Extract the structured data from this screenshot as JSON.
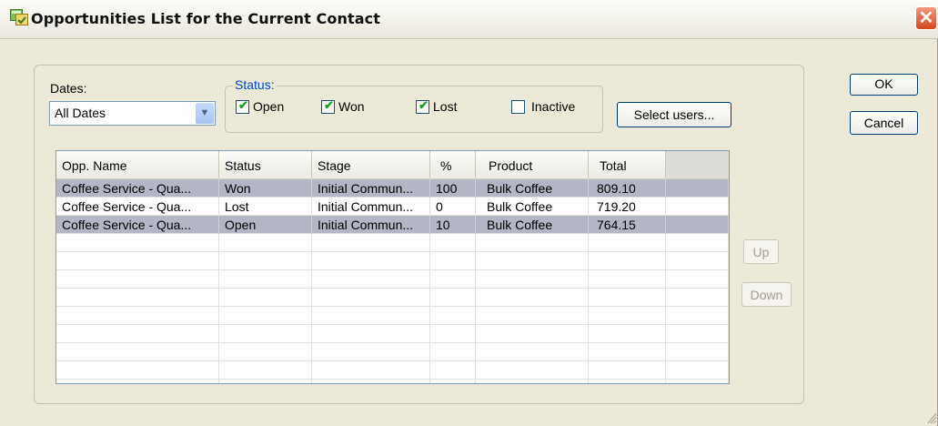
{
  "window": {
    "title": "Opportunities List for the Current Contact",
    "close_label": "✕"
  },
  "buttons": {
    "ok": "OK",
    "cancel": "Cancel",
    "select_users": "Select users...",
    "up": "Up",
    "down": "Down"
  },
  "dates": {
    "label": "Dates:",
    "value": "All Dates"
  },
  "status": {
    "label": "Status:",
    "options": [
      {
        "label": "Open",
        "checked": true
      },
      {
        "label": "Won",
        "checked": true
      },
      {
        "label": "Lost",
        "checked": true
      },
      {
        "label": "Inactive",
        "checked": false
      }
    ]
  },
  "grid": {
    "columns": [
      "Opp. Name",
      "Status",
      "Stage",
      "%",
      "Product",
      "Total"
    ],
    "rows": [
      {
        "cells": [
          "Coffee Service - Qua...",
          "Won",
          "Initial Commun...",
          "100",
          "Bulk Coffee",
          "809.10"
        ],
        "selected": true
      },
      {
        "cells": [
          "Coffee Service - Qua...",
          "Lost",
          "Initial Commun...",
          "0",
          "Bulk Coffee",
          "719.20"
        ],
        "selected": false
      },
      {
        "cells": [
          "Coffee Service - Qua...",
          "Open",
          "Initial Commun...",
          "10",
          "Bulk Coffee",
          "764.15"
        ],
        "selected": true
      }
    ],
    "empty_rows": 9
  },
  "colors": {
    "check": "#21a121",
    "status_label": "#0046d5",
    "selected_row": "#b3b6c4",
    "close_button": "#d2461f"
  }
}
